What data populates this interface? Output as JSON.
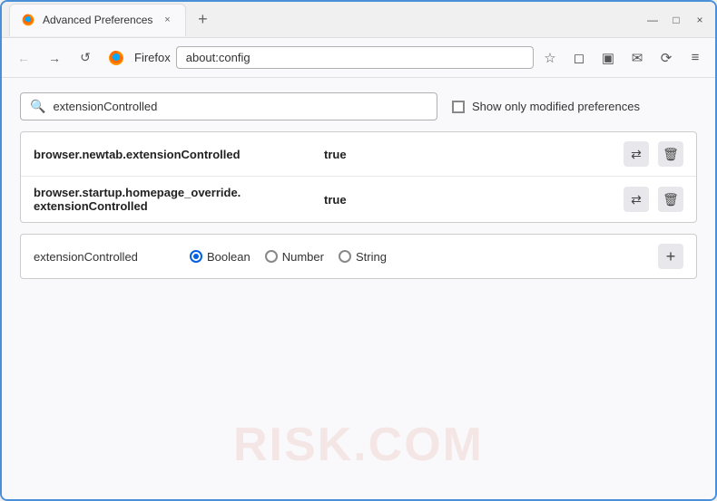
{
  "window": {
    "title": "Advanced Preferences",
    "tab_close": "×",
    "new_tab": "+",
    "win_minimize": "—",
    "win_maximize": "□",
    "win_close": "×"
  },
  "navbar": {
    "back_icon": "←",
    "forward_icon": "→",
    "reload_icon": "↺",
    "browser_name": "Firefox",
    "address": "about:config",
    "bookmark_icon": "☆",
    "pocket_icon": "◻",
    "ext_icon": "▣",
    "reader_icon": "✉",
    "compat_icon": "⟳",
    "menu_icon": "≡"
  },
  "search": {
    "placeholder": "extensionControlled",
    "value": "extensionControlled",
    "show_modified_label": "Show only modified preferences",
    "show_modified_checked": false
  },
  "results": [
    {
      "name": "browser.newtab.extensionControlled",
      "value": "true"
    },
    {
      "name_line1": "browser.startup.homepage_override.",
      "name_line2": "extensionControlled",
      "value": "true"
    }
  ],
  "new_pref": {
    "name": "extensionControlled",
    "type_options": [
      "Boolean",
      "Number",
      "String"
    ],
    "selected_type": "Boolean",
    "add_label": "+"
  },
  "watermark": "RISK.COM",
  "icons": {
    "swap": "⇄",
    "delete": "🗑",
    "search": "🔍",
    "add": "+"
  }
}
